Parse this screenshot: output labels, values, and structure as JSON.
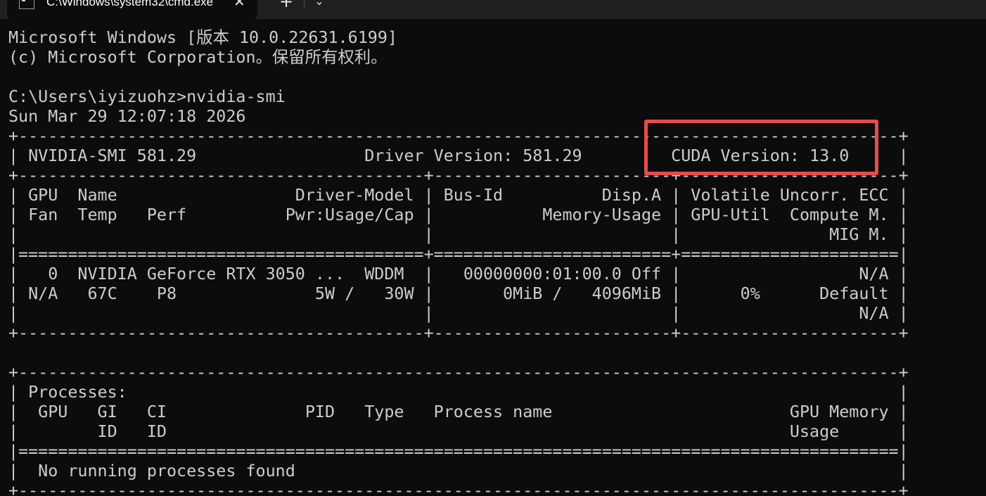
{
  "tabbar": {
    "tab_title": "C:\\Windows\\system32\\cmd.exe",
    "tab_icon": "terminal-icon",
    "close_symbol": "✕",
    "new_tab_symbol": "+",
    "dropdown_symbol": "⌄"
  },
  "terminal": {
    "lines": [
      "Microsoft Windows [版本 10.0.22631.6199]",
      "(c) Microsoft Corporation。保留所有权利。",
      "",
      "C:\\Users\\iyizuohz>nvidia-smi",
      "Sun Mar 29 12:07:18 2026",
      "+-----------------------------------------------------------------------------------------+",
      "| NVIDIA-SMI 581.29                 Driver Version: 581.29         CUDA Version: 13.0     |",
      "+-----------------------------------------+------------------------+----------------------+",
      "| GPU  Name                  Driver-Model | Bus-Id          Disp.A | Volatile Uncorr. ECC |",
      "| Fan  Temp   Perf          Pwr:Usage/Cap |           Memory-Usage | GPU-Util  Compute M. |",
      "|                                         |                        |               MIG M. |",
      "|=========================================+========================+======================|",
      "|   0  NVIDIA GeForce RTX 3050 ...  WDDM  |   00000000:01:00.0 Off |                  N/A |",
      "| N/A   67C    P8              5W /   30W |       0MiB /   4096MiB |      0%      Default |",
      "|                                         |                        |                  N/A |",
      "+-----------------------------------------+------------------------+----------------------+",
      "",
      "+-----------------------------------------------------------------------------------------+",
      "| Processes:                                                                              |",
      "|  GPU   GI   CI              PID   Type   Process name                        GPU Memory |",
      "|        ID   ID                                                               Usage      |",
      "|=========================================================================================|",
      "|  No running processes found                                                             |",
      "+-----------------------------------------------------------------------------------------+"
    ]
  },
  "colors": {
    "background": "#0c0c0c",
    "text": "#cccccc",
    "tabbar": "#202020",
    "highlight": "#e84b4b"
  }
}
